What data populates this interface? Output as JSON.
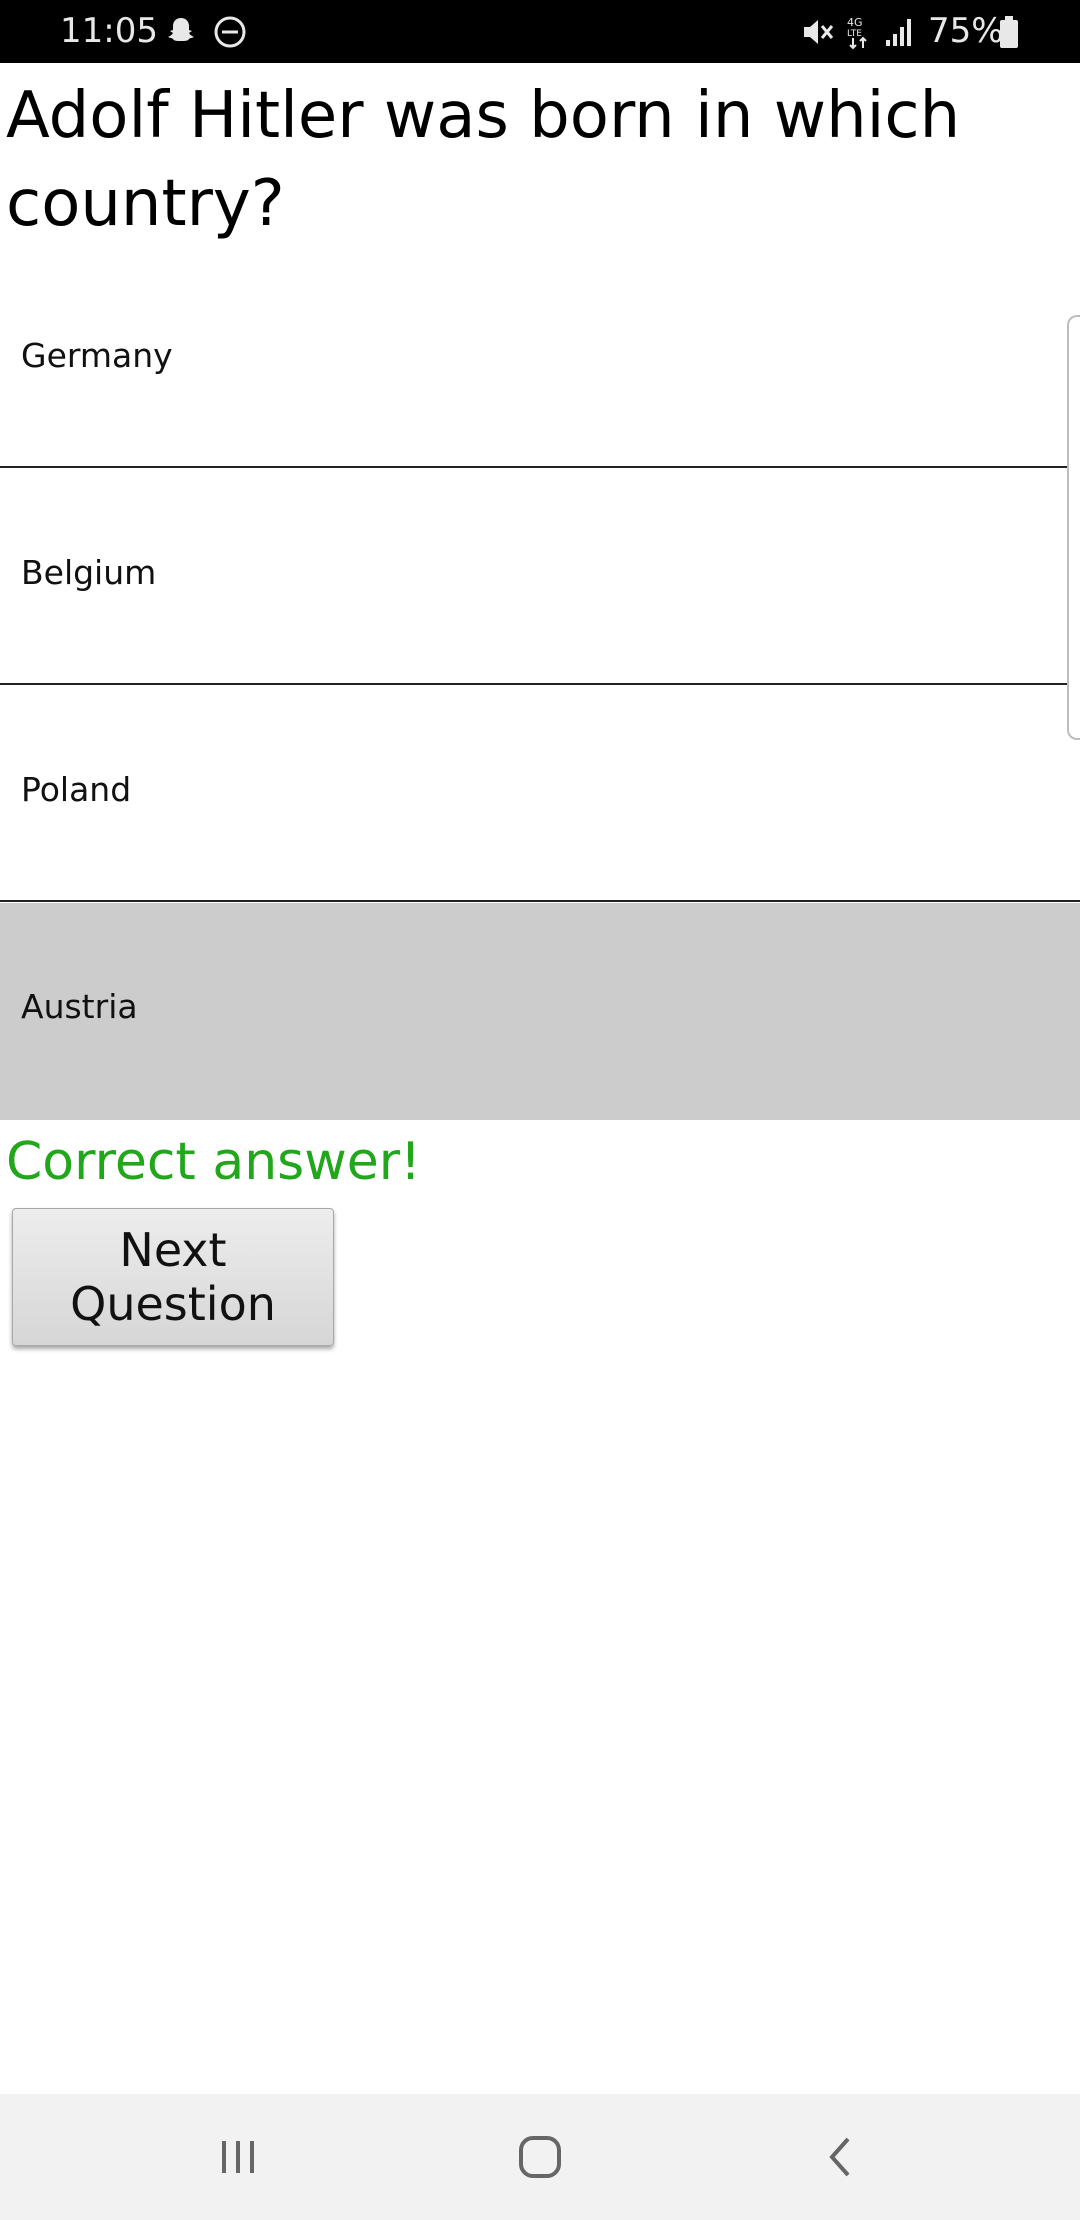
{
  "status_bar": {
    "time": "11:05",
    "battery": "75%",
    "icons": [
      "snapchat-notification-icon",
      "do-not-disturb-icon",
      "mute-icon",
      "4g-lte-icon",
      "signal-icon",
      "battery-icon"
    ]
  },
  "quiz": {
    "question": "Adolf Hitler was born in which country?",
    "options": [
      {
        "label": "Germany",
        "selected": false
      },
      {
        "label": "Belgium",
        "selected": false
      },
      {
        "label": "Poland",
        "selected": false
      },
      {
        "label": "Austria",
        "selected": true
      }
    ],
    "result_text": "Correct answer!",
    "result_color": "#22a61c",
    "selected_color": "#cccccc",
    "next_button_label": "Next Question"
  },
  "nav_bar": {
    "buttons": [
      "recent-apps-icon",
      "home-icon",
      "back-icon"
    ]
  }
}
